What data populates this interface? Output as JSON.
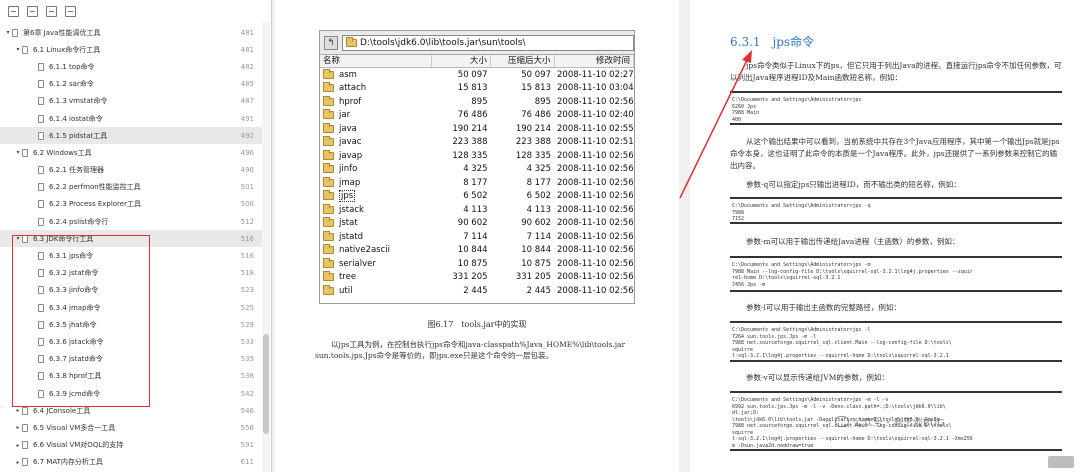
{
  "outline": [
    {
      "label": "第6章 Java性能调优工具",
      "page": "481",
      "level": 1,
      "tw": "▾",
      "sel": false
    },
    {
      "label": "6.1 Linux命令行工具",
      "page": "481",
      "level": 2,
      "tw": "▾",
      "sel": false
    },
    {
      "label": "6.1.1 top命令",
      "page": "482",
      "level": 3,
      "tw": "",
      "sel": false
    },
    {
      "label": "6.1.2 sar命令",
      "page": "485",
      "level": 3,
      "tw": "",
      "sel": false
    },
    {
      "label": "6.1.3 vmstat命令",
      "page": "487",
      "level": 3,
      "tw": "",
      "sel": false
    },
    {
      "label": "6.1.4 iostat命令",
      "page": "491",
      "level": 3,
      "tw": "",
      "sel": false
    },
    {
      "label": "6.1.5 pidstat工具",
      "page": "492",
      "level": 3,
      "tw": "",
      "sel": true
    },
    {
      "label": "6.2 Windows工具",
      "page": "496",
      "level": 2,
      "tw": "▾",
      "sel": false
    },
    {
      "label": "6.2.1 任务管理器",
      "page": "496",
      "level": 3,
      "tw": "",
      "sel": false
    },
    {
      "label": "6.2.2 perfmon性能监控工具",
      "page": "501",
      "level": 3,
      "tw": "",
      "sel": false
    },
    {
      "label": "6.2.3 Process Explorer工具",
      "page": "508",
      "level": 3,
      "tw": "",
      "sel": false
    },
    {
      "label": "6.2.4 pslist命令行",
      "page": "512",
      "level": 3,
      "tw": "",
      "sel": false
    },
    {
      "label": "6.3 JDK命令行工具",
      "page": "516",
      "level": 2,
      "tw": "▾",
      "sel": true
    },
    {
      "label": "6.3.1 jps命令",
      "page": "516",
      "level": 3,
      "tw": "",
      "sel": false
    },
    {
      "label": "6.3.2 jstat命令",
      "page": "518",
      "level": 3,
      "tw": "",
      "sel": false
    },
    {
      "label": "6.3.3 jinfo命令",
      "page": "523",
      "level": 3,
      "tw": "",
      "sel": false
    },
    {
      "label": "6.3.4 jmap命令",
      "page": "525",
      "level": 3,
      "tw": "",
      "sel": false
    },
    {
      "label": "6.3.5 jhat命令",
      "page": "529",
      "level": 3,
      "tw": "",
      "sel": false
    },
    {
      "label": "6.3.6 jstack命令",
      "page": "533",
      "level": 3,
      "tw": "",
      "sel": false
    },
    {
      "label": "6.3.7 jstatd命令",
      "page": "535",
      "level": 3,
      "tw": "",
      "sel": false
    },
    {
      "label": "6.3.8 hprof工具",
      "page": "538",
      "level": 3,
      "tw": "",
      "sel": false
    },
    {
      "label": "6.3.9 jcmd命令",
      "page": "542",
      "level": 3,
      "tw": "",
      "sel": false
    },
    {
      "label": "6.4 JConsole工具",
      "page": "546",
      "level": 2,
      "tw": "▸",
      "sel": false
    },
    {
      "label": "6.5 Visual VM多合一工具",
      "page": "556",
      "level": 2,
      "tw": "▸",
      "sel": false
    },
    {
      "label": "6.6 Visual VM对OQL的支持",
      "page": "591",
      "level": 2,
      "tw": "▸",
      "sel": false
    },
    {
      "label": "6.7 MAT内存分析工具",
      "page": "611",
      "level": 2,
      "tw": "▸",
      "sel": false
    }
  ],
  "explorer": {
    "path": "D:\\tools\\jdk6.0\\lib\\tools.jar\\sun\\tools\\",
    "headers": [
      "名称",
      "大小",
      "压缩后大小",
      "修改时间"
    ],
    "rows": [
      {
        "name": "asm",
        "size": "50 097",
        "packed": "50 097",
        "time": "2008-11-10 02:27"
      },
      {
        "name": "attach",
        "size": "15 813",
        "packed": "15 813",
        "time": "2008-11-10 03:04"
      },
      {
        "name": "hprof",
        "size": "895",
        "packed": "895",
        "time": "2008-11-10 02:56"
      },
      {
        "name": "jar",
        "size": "76 486",
        "packed": "76 486",
        "time": "2008-11-10 02:40"
      },
      {
        "name": "java",
        "size": "190 214",
        "packed": "190 214",
        "time": "2008-11-10 02:55"
      },
      {
        "name": "javac",
        "size": "223 388",
        "packed": "223 388",
        "time": "2008-11-10 02:51"
      },
      {
        "name": "javap",
        "size": "128 335",
        "packed": "128 335",
        "time": "2008-11-10 02:56"
      },
      {
        "name": "jinfo",
        "size": "4 325",
        "packed": "4 325",
        "time": "2008-11-10 02:56"
      },
      {
        "name": "jmap",
        "size": "8 177",
        "packed": "8 177",
        "time": "2008-11-10 02:56"
      },
      {
        "name": "jps",
        "size": "6 502",
        "packed": "6 502",
        "time": "2008-11-10 02:56"
      },
      {
        "name": "jstack",
        "size": "4 113",
        "packed": "4 113",
        "time": "2008-11-10 02:56"
      },
      {
        "name": "jstat",
        "size": "90 602",
        "packed": "90 602",
        "time": "2008-11-10 02:56"
      },
      {
        "name": "jstatd",
        "size": "7 114",
        "packed": "7 114",
        "time": "2008-11-10 02:56"
      },
      {
        "name": "native2ascii",
        "size": "10 844",
        "packed": "10 844",
        "time": "2008-11-10 02:56"
      },
      {
        "name": "serialver",
        "size": "10 875",
        "packed": "10 875",
        "time": "2008-11-10 02:56"
      },
      {
        "name": "tree",
        "size": "331 205",
        "packed": "331 205",
        "time": "2008-11-10 02:56"
      },
      {
        "name": "util",
        "size": "2 445",
        "packed": "2 445",
        "time": "2008-11-10 02:56"
      }
    ]
  },
  "page1": {
    "caption": "图6.17　tools.jar中的实现",
    "paragraph": "以jps工具为例，在控制台执行jps命令和java-classpath%Java_HOME%\\lib\\tools.jar sun.tools.jps.Jps命令是等价的，即jps.exe只是这个命令的一层包装。"
  },
  "page2": {
    "title": "6.3.1　jps命令",
    "p1": "jps命令类似于Linux下的ps，但它只用于列出Java的进程。直接运行jps命令不加任何参数，可以列出Java程序进程ID及Main函数短名称，例如：",
    "code1": "C:\\Documents and Settings\\Administrator>jps\n6260 Jps\n7988 Main\n400",
    "p2": "从这个输出结果中可以看到，当前系统中共存在3个Java应用程序，其中第一个输出Jps就是jps命令本身，这也证明了此命令的本质是一个Java程序。此外，jps还提供了一系列参数来控制它的输出内容。",
    "p3": "参数-q可以指定jps只输出进程ID，而不输出类的短名称，例如：",
    "code2": "C:\\Documents and Settings\\Administrator>jps -q\n7988\n7152",
    "p4": "参数-m可以用于输出传递给Java进程（主函数）的参数，例如：",
    "code3": "C:\\Documents and Settings\\Administrator>jps -m\n7988 Main --log-config-file D:\\tools\\squirrel-sql-3.2.1\\log4j.properties --squir\nrel-home D:\\tools\\squirrel-sql-3.2.1\n7456 Jps -m",
    "p5": "参数-l可以用于输出主函数的完整路径，例如：",
    "code4": "C:\\Documents and Settings\\Administrator>jps -l\n7264 sun.tools.jps.Jps -m -l\n7988 net.sourceforge.squirrel_sql.client.Main --log-config-file D:\\tools\\\nsquirre\nl-sql-3.2.1\\log4j.properties --squirrel-home D:\\tools\\squirrel-sql-3.2.1",
    "p6": "参数-v可以显示传递给JVM的参数，例如：",
    "code5": "C:\\Documents and Settings\\Administrator>jps -m -l -v\n6992 sun.tools.jps.Jps -m -l -v -Denv.class.path=.;D:\\tools\\jdk6.0\\lib\\\ndt.jar;D:\n\\tools\\jdk6.0\\lib\\tools.jar -Dapplication.home=D:\\tools\\jdk6.0 -Xms8m\n7988 net.sourceforge.squirrel_sql.client.Main --log-config-file D:\\tools\\\nsquirre\nl-sql-3.2.1\\log4j.properties --squirrel-home D:\\tools\\squirrel-sql-3.2.1 -Xmx256\nm -Dsun.java2d.noddraw=true"
  },
  "watermark": "公众号・老王谈BUG"
}
